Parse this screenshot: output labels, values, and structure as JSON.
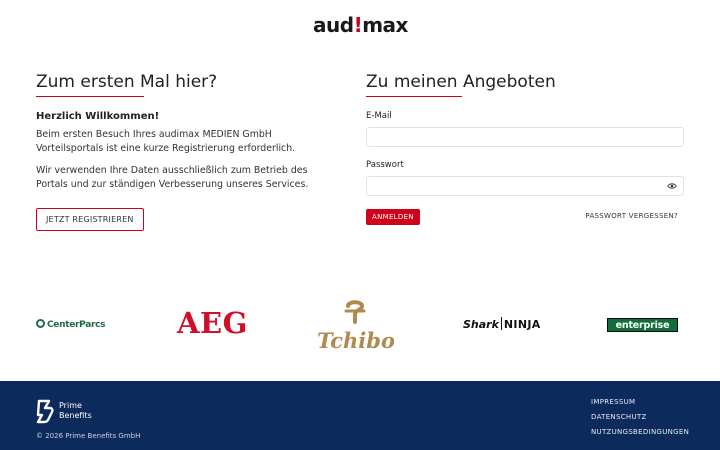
{
  "header": {
    "logo_main": "aud",
    "logo_bang": "!",
    "logo_end": "max"
  },
  "register": {
    "title": "Zum ersten Mal hier?",
    "welcome": "Herzlich Willkommen!",
    "para1": "Beim ersten Besuch Ihres audimax MEDIEN GmbH Vorteilsportals ist eine kurze Registrierung erforderlich.",
    "para2": "Wir verwenden Ihre Daten ausschließlich zum Betrieb des Portals und zur ständigen Verbesserung unseres Services.",
    "button": "JETZT REGISTRIEREN"
  },
  "login": {
    "title": "Zu meinen Angeboten",
    "email_label": "E-Mail",
    "email_value": "",
    "password_label": "Passwort",
    "password_value": "",
    "submit": "ANMELDEN",
    "forgot": "PASSWORT VERGESSEN?"
  },
  "brands": {
    "centerparcs": "CenterParcs",
    "aeg": "AEG",
    "tchibo": "Tchibo",
    "shark": "Shark",
    "ninja": "NINJA",
    "enterprise": "enterprise"
  },
  "footer": {
    "brand_line1": "Prime",
    "brand_line2": "Benefits",
    "copyright": "© 2026 Prime Benefits GmbH",
    "links": [
      "IMPRESSUM",
      "DATENSCHUTZ",
      "NUTZUNGSBEDINGUNGEN"
    ]
  },
  "colors": {
    "accent": "#d0021b",
    "footer_bg": "#0c2a5b"
  },
  "icons": {
    "password_toggle": "eye-icon",
    "footer_logo": "prime-benefits-logo"
  }
}
